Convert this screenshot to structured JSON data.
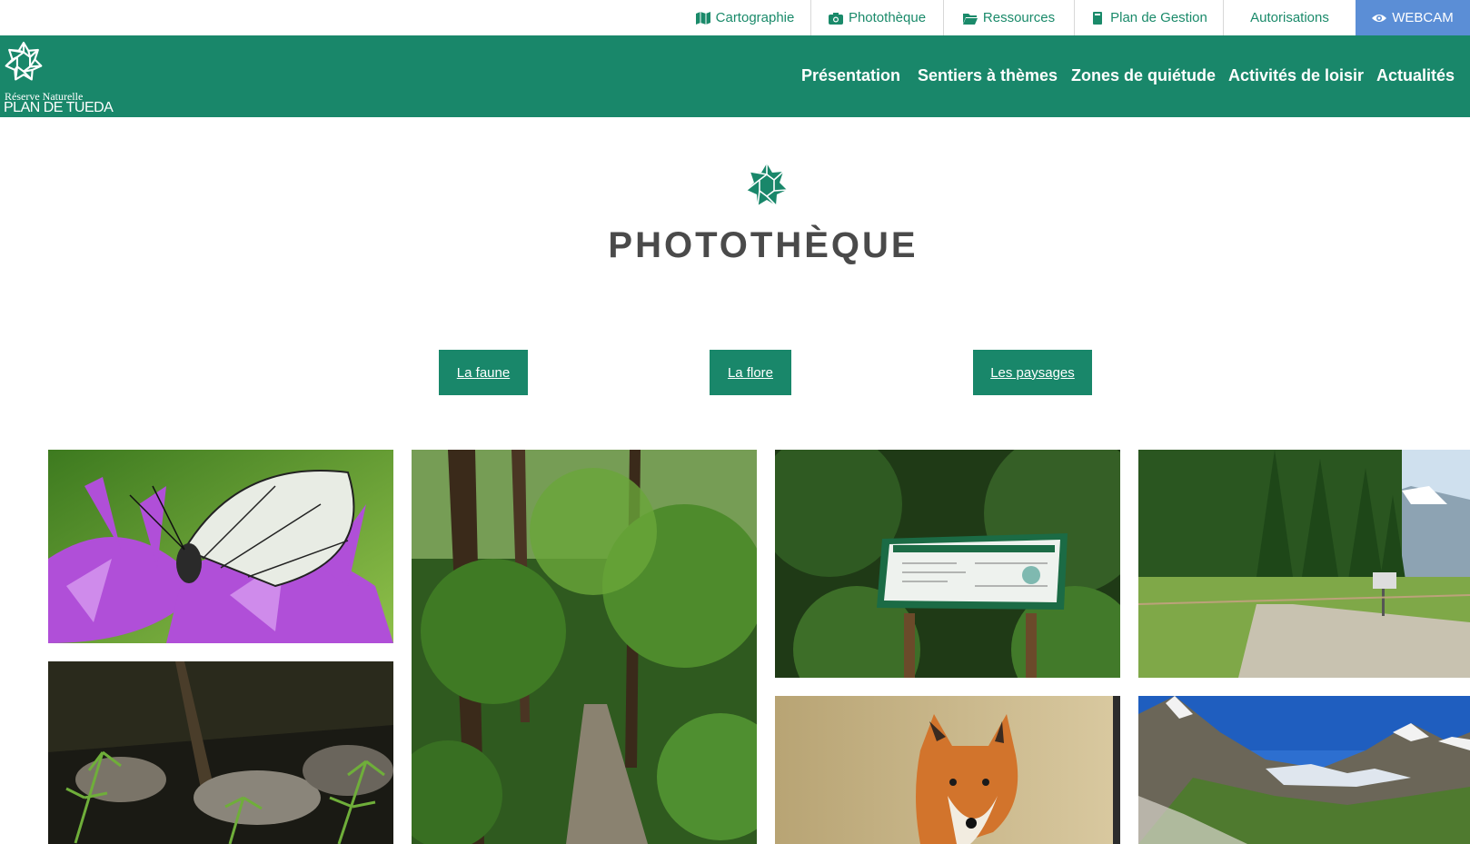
{
  "topbar": {
    "items": [
      {
        "label": "Cartographie",
        "icon": "map-icon"
      },
      {
        "label": "Photothèque",
        "icon": "camera-icon"
      },
      {
        "label": "Ressources",
        "icon": "folder-icon"
      },
      {
        "label": "Plan de Gestion",
        "icon": "book-icon"
      },
      {
        "label": "Autorisations",
        "icon": ""
      },
      {
        "label": "WEBCAM",
        "icon": "eye-icon"
      }
    ],
    "webcam_color": "#5b8ed6"
  },
  "logo": {
    "subtitle": "Réserve Naturelle",
    "name": "PLAN DE TUEDA"
  },
  "mainnav": {
    "items": [
      "Présentation",
      "Sentiers à thèmes",
      "Zones de quiétude",
      "Activités de loisir",
      "Actualités"
    ],
    "color": "#19876a"
  },
  "page": {
    "title": "PHOTOTHÈQUE"
  },
  "filters": [
    "La faune",
    "La flore",
    "Les paysages"
  ],
  "gallery": {
    "photos": [
      {
        "subject": "butterfly-on-purple-flower"
      },
      {
        "subject": "forest-trail"
      },
      {
        "subject": "information-panel-in-forest"
      },
      {
        "subject": "meadow-and-path-with-mountains"
      },
      {
        "subject": "rocks-and-ferns"
      },
      {
        "subject": "red-fox"
      },
      {
        "subject": "snowy-mountain-valley"
      }
    ]
  }
}
